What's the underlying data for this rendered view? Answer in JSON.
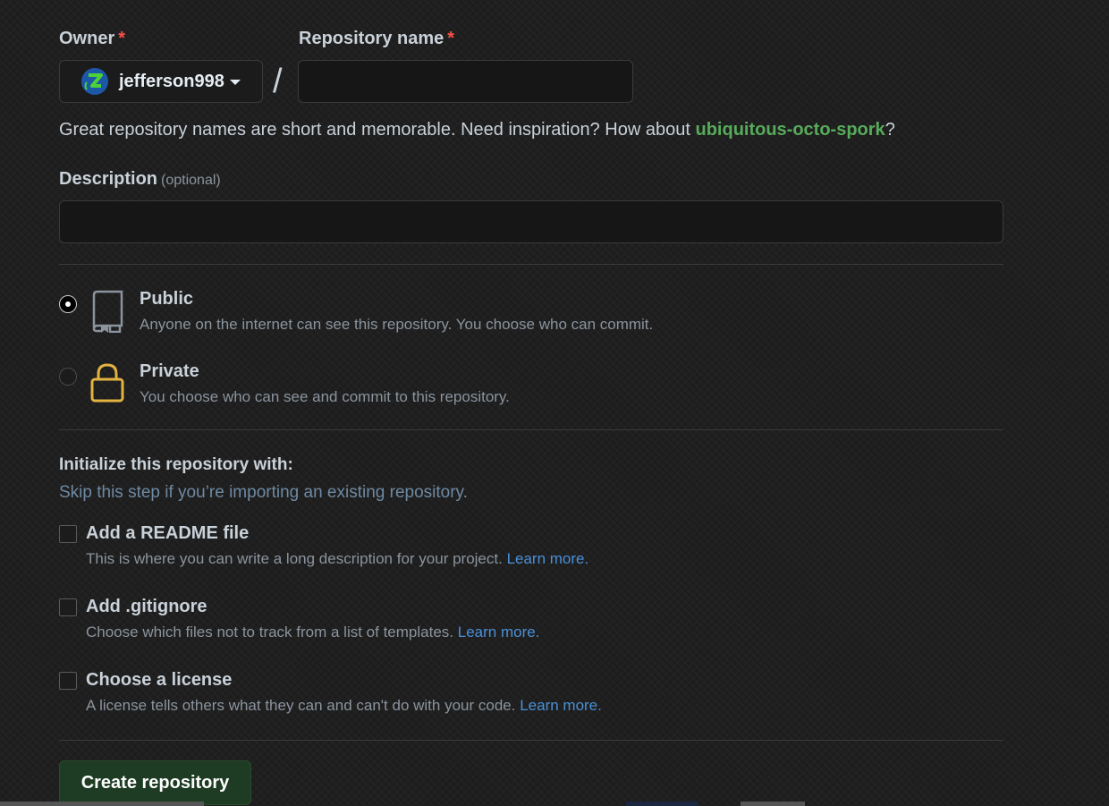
{
  "owner": {
    "label": "Owner",
    "required_mark": "*",
    "selected": "jefferson998"
  },
  "repo_name": {
    "label": "Repository name",
    "required_mark": "*",
    "value": "",
    "placeholder": ""
  },
  "separator": "/",
  "name_hint": {
    "prefix": "Great repository names are short and memorable. Need inspiration? How about ",
    "suggestion": "ubiquitous-octo-spork",
    "suffix": "?"
  },
  "description": {
    "label": "Description",
    "optional": "(optional)",
    "value": ""
  },
  "visibility": {
    "selected": "public",
    "options": [
      {
        "title": "Public",
        "desc": "Anyone on the internet can see this repository. You choose who can commit."
      },
      {
        "title": "Private",
        "desc": "You choose who can see and commit to this repository."
      }
    ]
  },
  "init": {
    "title": "Initialize this repository with:",
    "subtitle": "Skip this step if you’re importing an existing repository.",
    "options": [
      {
        "title": "Add a README file",
        "desc": "This is where you can write a long description for your project.",
        "link": "Learn more."
      },
      {
        "title": "Add .gitignore",
        "desc": "Choose which files not to track from a list of templates.",
        "link": "Learn more."
      },
      {
        "title": "Choose a license",
        "desc": "A license tells others what they can and can't do with your code.",
        "link": "Learn more."
      }
    ]
  },
  "submit": {
    "label": "Create repository"
  },
  "colors": {
    "background": "#1f1f1f",
    "required": "#f85149",
    "suggestion": "#57ab5a",
    "link": "#4a90d9",
    "create_button": "#1e3c23",
    "private_lock": "#e3b341"
  }
}
